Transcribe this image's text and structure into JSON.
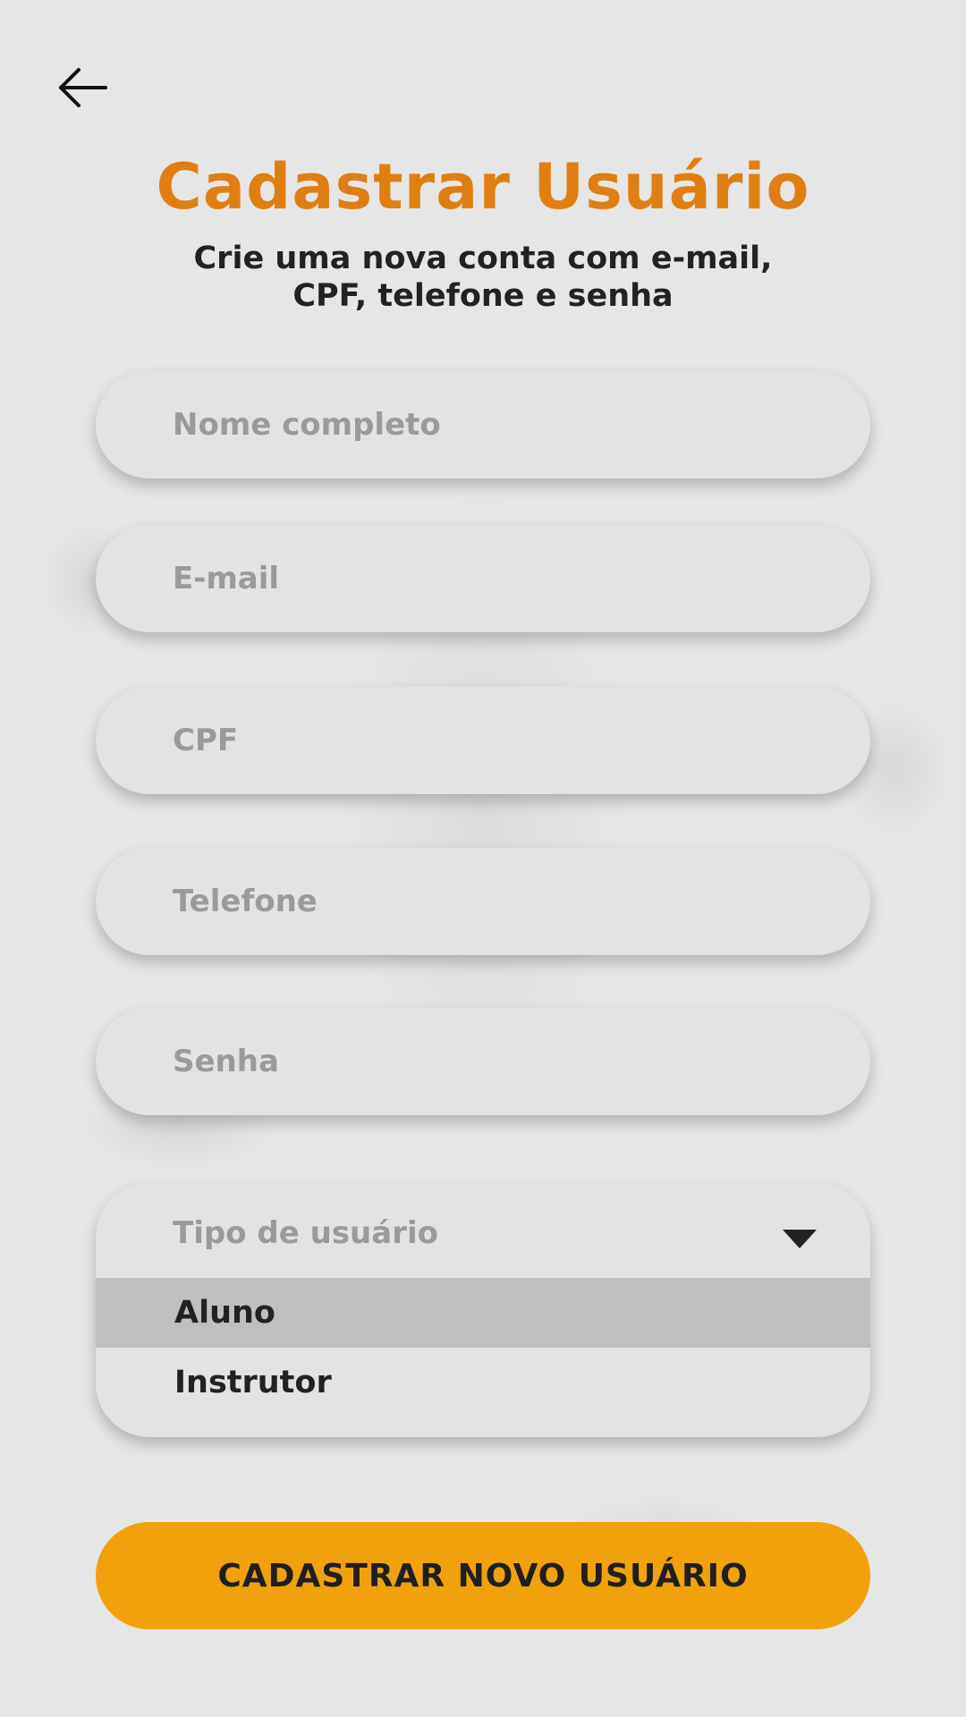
{
  "header": {
    "back_icon": "arrow-left-icon",
    "title": "Cadastrar Usuário",
    "subtitle_line1": "Crie uma nova conta com e-mail,",
    "subtitle_line2": "CPF, telefone e senha"
  },
  "form": {
    "name_placeholder": "Nome completo",
    "email_placeholder": "E-mail",
    "cpf_placeholder": "CPF",
    "phone_placeholder": "Telefone",
    "password_placeholder": "Senha",
    "user_type": {
      "label": "Tipo de usuário",
      "caret_icon": "caret-down-icon",
      "options": [
        "Aluno",
        "Instrutor"
      ],
      "highlighted": "Aluno"
    },
    "submit_label": "CADASTRAR NOVO USUÁRIO"
  },
  "colors": {
    "title": "#df7f12",
    "button": "#f0a10c",
    "background": "#e6e6e6"
  }
}
